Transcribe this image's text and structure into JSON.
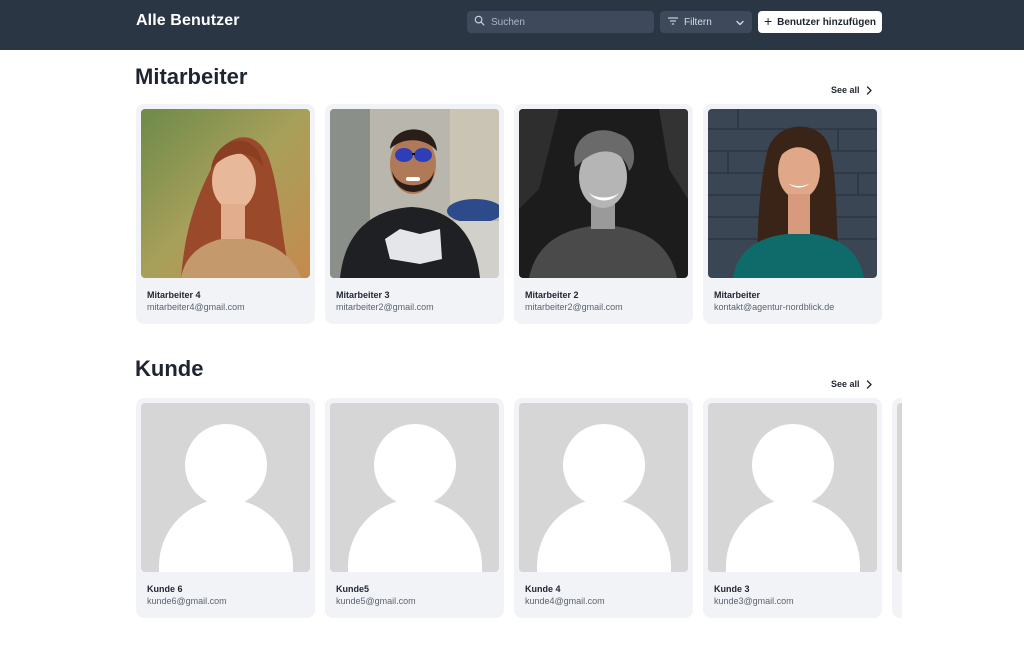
{
  "header": {
    "title": "Alle Benutzer",
    "search_placeholder": "Suchen",
    "filter_label": "Filtern",
    "add_button_label": "Benutzer hinzufügen"
  },
  "sections": [
    {
      "title": "Mitarbeiter",
      "see_all": "See all",
      "users": [
        {
          "name": "Mitarbeiter 4",
          "email": "mitarbeiter4@gmail.com",
          "photo": "woman-red-hair-photo"
        },
        {
          "name": "Mitarbeiter 3",
          "email": "mitarbeiter2@gmail.com",
          "photo": "man-sunglasses-photo"
        },
        {
          "name": "Mitarbeiter 2",
          "email": "mitarbeiter2@gmail.com",
          "photo": "man-black-white-photo"
        },
        {
          "name": "Mitarbeiter",
          "email": "kontakt@agentur-nordblick.de",
          "photo": "woman-brick-wall-photo"
        }
      ]
    },
    {
      "title": "Kunde",
      "see_all": "See all",
      "users": [
        {
          "name": "Kunde 6",
          "email": "kunde6@gmail.com",
          "photo": "default-avatar"
        },
        {
          "name": "Kunde5",
          "email": "kunde5@gmail.com",
          "photo": "default-avatar"
        },
        {
          "name": "Kunde 4",
          "email": "kunde4@gmail.com",
          "photo": "default-avatar"
        },
        {
          "name": "Kunde 3",
          "email": "kunde3@gmail.com",
          "photo": "default-avatar"
        }
      ]
    }
  ],
  "colors": {
    "header_bg": "#2b3645",
    "card_bg": "#f1f3f6",
    "avatar_bg": "#d6d6d6"
  }
}
